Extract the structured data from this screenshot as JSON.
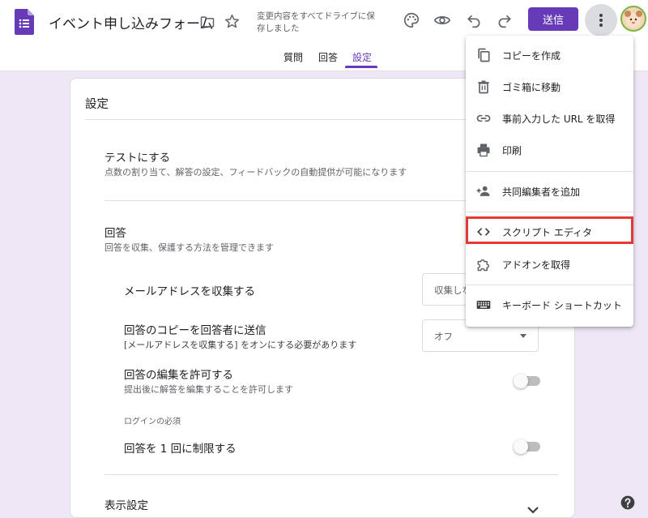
{
  "header": {
    "title": "イベント申し込みフォーム",
    "save_status": "変更内容をすべてドライブに保存しました",
    "send_label": "送信"
  },
  "tabs": [
    {
      "label": "質問"
    },
    {
      "label": "回答"
    },
    {
      "label": "設定",
      "active": true
    }
  ],
  "settings": {
    "title": "設定",
    "quiz": {
      "title": "テストにする",
      "desc": "点数の割り当て、解答の設定、フィードバックの自動提供が可能になります"
    },
    "responses": {
      "title": "回答",
      "desc": "回答を収集、保護する方法を管理できます",
      "collect_email": {
        "label": "メールアドレスを収集する",
        "value": "収集しない"
      },
      "send_copy": {
        "label": "回答のコピーを回答者に送信",
        "desc": "[メールアドレスを収集する] をオンにする必要があります",
        "value": "オフ"
      },
      "allow_edit": {
        "label": "回答の編集を許可する",
        "desc": "提出後に解答を編集することを許可します"
      },
      "login_required_label": "ログインの必須",
      "limit_one": {
        "label": "回答を 1 回に制限する"
      }
    },
    "presentation": {
      "title": "表示設定"
    }
  },
  "menu": {
    "items": [
      {
        "label": "コピーを作成",
        "icon": "copy-icon"
      },
      {
        "label": "ゴミ箱に移動",
        "icon": "trash-icon"
      },
      {
        "label": "事前入力した URL を取得",
        "icon": "link-icon"
      },
      {
        "label": "印刷",
        "icon": "print-icon"
      },
      {
        "label": "共同編集者を追加",
        "icon": "person-add-icon"
      },
      {
        "label": "スクリプト エディタ",
        "icon": "code-icon",
        "highlighted": true
      },
      {
        "label": "アドオンを取得",
        "icon": "puzzle-icon"
      },
      {
        "label": "キーボード ショートカット",
        "icon": "keyboard-icon"
      }
    ]
  },
  "colors": {
    "accent": "#673ab7",
    "background": "#ede7f6",
    "highlight": "#e53935"
  }
}
